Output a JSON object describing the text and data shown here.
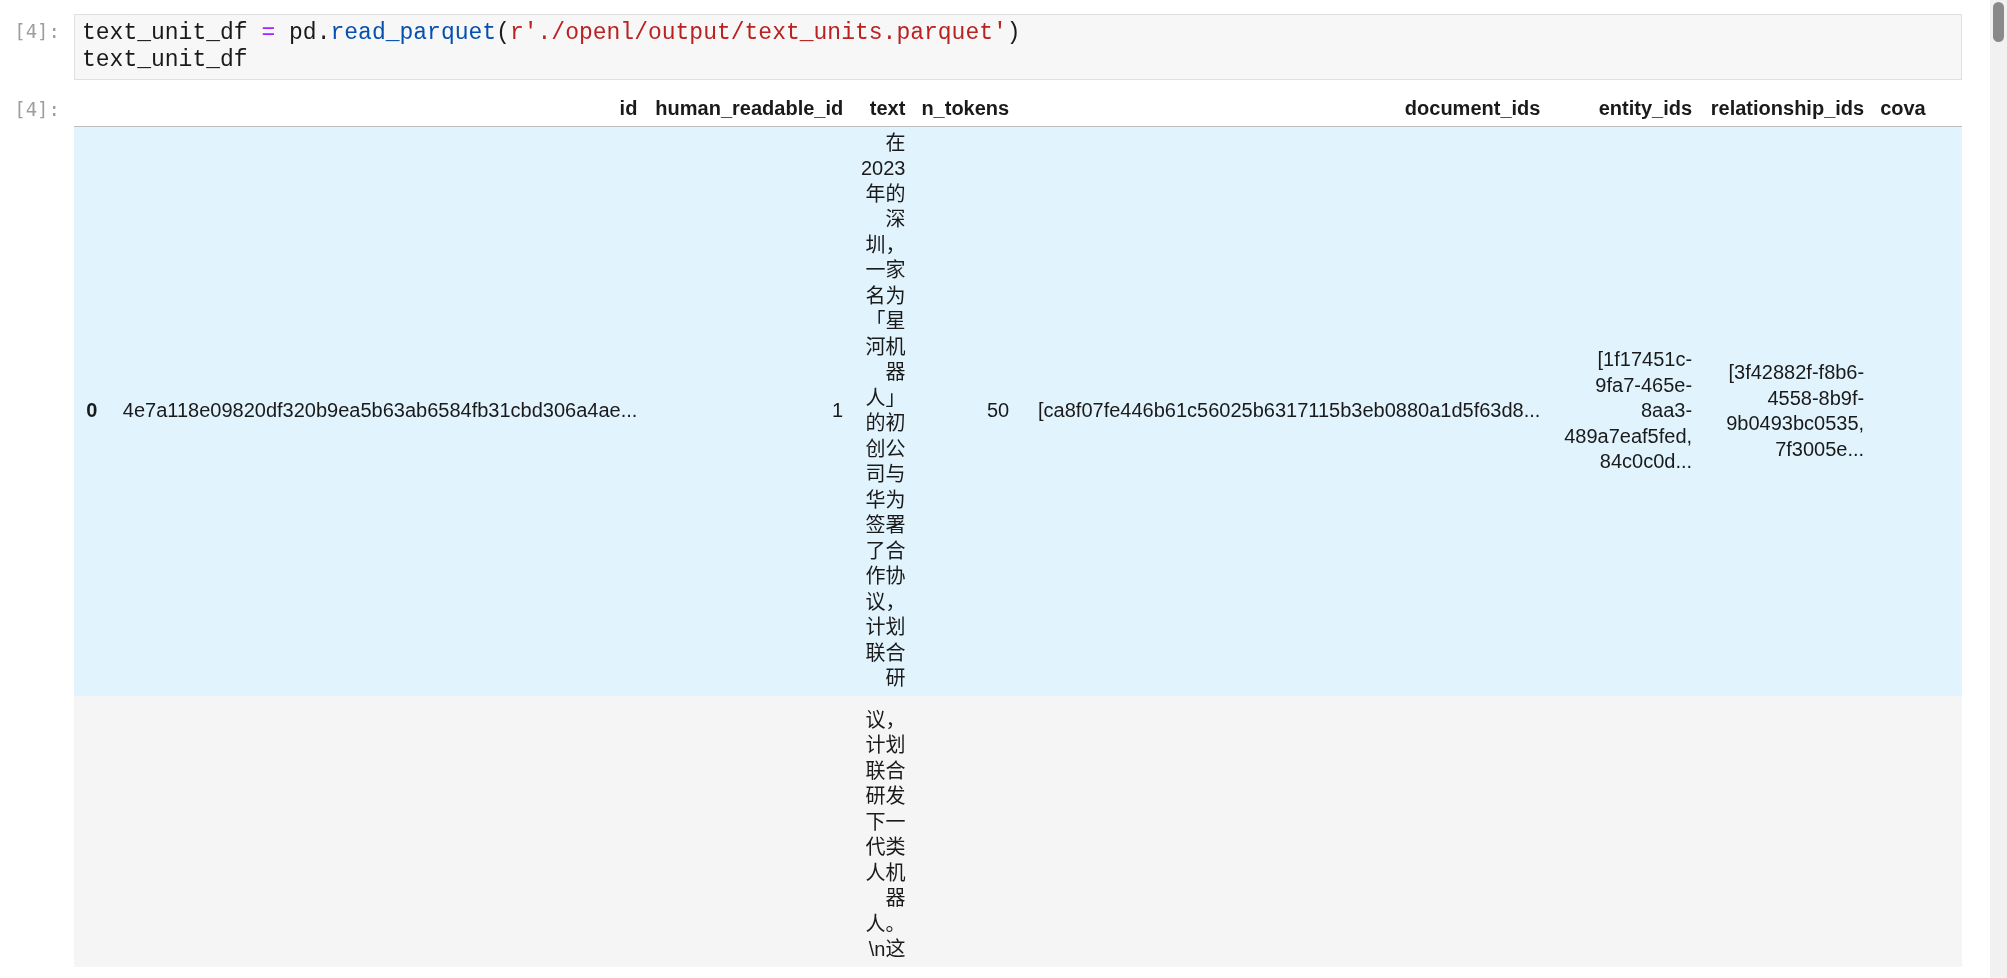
{
  "cells": [
    {
      "kind": "code",
      "prompt": "[4]:",
      "lines": [
        [
          {
            "kind": "plain",
            "text": "text_unit_df "
          },
          {
            "kind": "op",
            "text": "="
          },
          {
            "kind": "plain",
            "text": " pd."
          },
          {
            "kind": "func",
            "text": "read_parquet"
          },
          {
            "kind": "plain",
            "text": "("
          },
          {
            "kind": "string",
            "text": "r'./openl/output/text_units.parquet'"
          },
          {
            "kind": "plain",
            "text": ")"
          }
        ],
        [
          {
            "kind": "plain",
            "text": "text_unit_df"
          }
        ]
      ]
    },
    {
      "kind": "output",
      "prompt": "[4]:",
      "table": {
        "columns": [
          "id",
          "human_readable_id",
          "text",
          "n_tokens",
          "document_ids",
          "entity_ids",
          "relationship_ids",
          "cova"
        ],
        "rows": [
          {
            "index": "0",
            "highlighted": true,
            "cells": [
              "4e7a118e09820df320b9ea5b63ab6584fb31cbd306a4ae...",
              "1",
              "在2023年的深圳，一家名为「星河机器人」的初创公司与华为签署了合作协议，计划联合研",
              "50",
              "[ca8f07fe446b61c56025b6317115b3eb0880a1d5f63d8...",
              "[1f17451c-9fa7-465e-8aa3-489a7eaf5fed, 84c0c0d...",
              "[3f42882f-f8b6-4558-8b9f-9b0493bc0535, 7f3005e...",
              null
            ]
          },
          {
            "index": null,
            "highlighted": false,
            "cells": [
              null,
              null,
              "议，计划联合研发下一代类人机器人。\\n这",
              null,
              null,
              null,
              null,
              null
            ]
          }
        ]
      }
    }
  ]
}
